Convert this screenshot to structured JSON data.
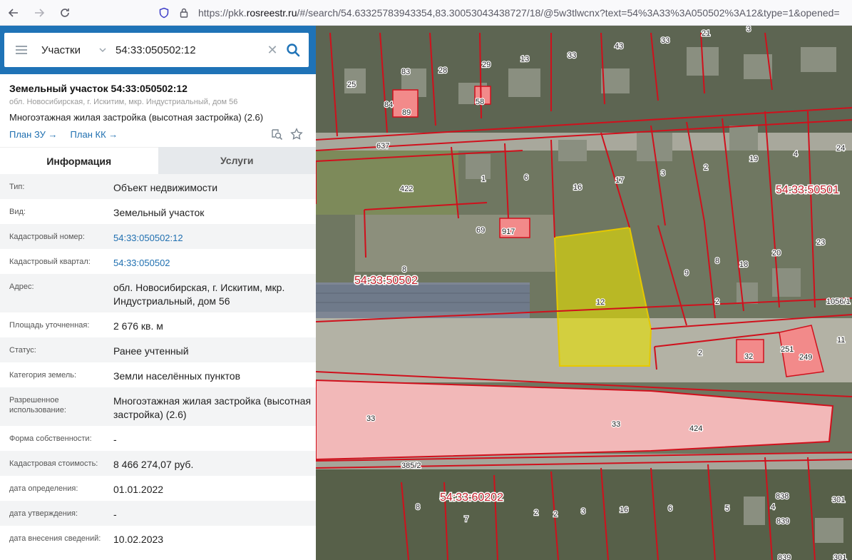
{
  "browser": {
    "url_prefix": "https://pkk.",
    "url_domain": "rosreestr.ru",
    "url_rest": "/#/search/54.63325783943354,83.30053043438727/18/@5w3tlwcnx?text=54%3A33%3A050502%3A12&type=1&opened="
  },
  "search": {
    "type": "Участки",
    "query": "54:33:050502:12"
  },
  "card": {
    "title": "Земельный участок 54:33:050502:12",
    "address": "обл. Новосибирская, г. Искитим, мкр. Индустриальный, дом 56",
    "usage": "Многоэтажная жилая застройка (высотная застройка) (2.6)",
    "link_plan_zu": "План ЗУ",
    "link_plan_kk": "План КК"
  },
  "tabs": [
    "Информация",
    "Услуги"
  ],
  "info": [
    {
      "label": "Тип:",
      "value": "Объект недвижимости"
    },
    {
      "label": "Вид:",
      "value": "Земельный участок"
    },
    {
      "label": "Кадастровый номер:",
      "value": "54:33:050502:12"
    },
    {
      "label": "Кадастровый квартал:",
      "value": "54:33:050502"
    },
    {
      "label": "Адрес:",
      "value": "обл. Новосибирская, г. Искитим, мкр. Индустриальный, дом 56"
    },
    {
      "label": "Площадь уточненная:",
      "value": "2 676 кв. м"
    },
    {
      "label": "Статус:",
      "value": "Ранее учтенный"
    },
    {
      "label": "Категория земель:",
      "value": "Земли населённых пунктов"
    },
    {
      "label": "Разрешенное использование:",
      "value": "Многоэтажная жилая застройка (высотная застройка) (2.6)"
    },
    {
      "label": "Форма собственности:",
      "value": "-"
    },
    {
      "label": "Кадастровая стоимость:",
      "value": "8 466 274,07 руб."
    },
    {
      "label": "дата определения:",
      "value": "01.01.2022"
    },
    {
      "label": "дата утверждения:",
      "value": "-"
    },
    {
      "label": "дата внесения сведений:",
      "value": "10.02.2023"
    }
  ],
  "map": {
    "quarters": [
      "54:33:50502",
      "54:33:50501",
      "54:33:60202"
    ],
    "parcel_numbers": [
      "25",
      "83",
      "84",
      "28",
      "29",
      "13",
      "33",
      "43",
      "21",
      "3",
      "637",
      "422",
      "1",
      "6",
      "16",
      "17",
      "3",
      "2",
      "19",
      "4",
      "24",
      "917",
      "69",
      "8",
      "12",
      "9",
      "8",
      "18",
      "20",
      "23",
      "2",
      "32",
      "251",
      "249",
      "11",
      "1056/1",
      "33",
      "33",
      "424",
      "385/2",
      "8",
      "7",
      "2",
      "2",
      "3",
      "16",
      "6",
      "5",
      "4",
      "838",
      "839",
      "301",
      "839",
      "301",
      "58",
      "89",
      "2"
    ],
    "selected_parcel": "12",
    "colors": {
      "selected": "#e6e000",
      "boundary": "#d0101c",
      "road": "#f2b8b8"
    }
  }
}
